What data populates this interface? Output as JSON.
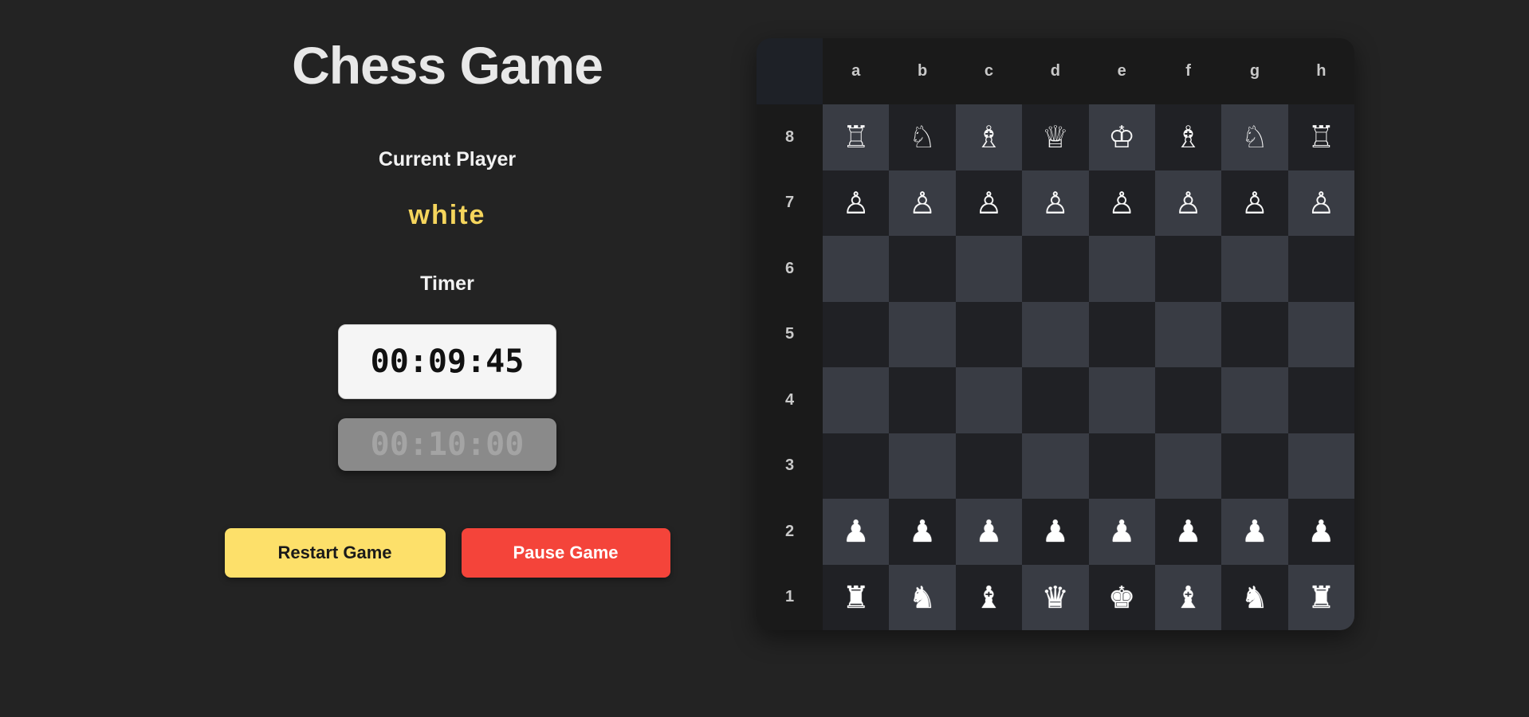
{
  "title": "Chess Game",
  "current_player_label": "Current Player",
  "current_player": "white",
  "timer_label": "Timer",
  "timers": {
    "active": "00:09:45",
    "inactive": "00:10:00"
  },
  "buttons": {
    "restart": "Restart Game",
    "pause": "Pause Game"
  },
  "board": {
    "files": [
      "a",
      "b",
      "c",
      "d",
      "e",
      "f",
      "g",
      "h"
    ],
    "ranks": [
      "8",
      "7",
      "6",
      "5",
      "4",
      "3",
      "2",
      "1"
    ],
    "pieces": [
      [
        "♖",
        "♘",
        "♗",
        "♕",
        "♔",
        "♗",
        "♘",
        "♖"
      ],
      [
        "♙",
        "♙",
        "♙",
        "♙",
        "♙",
        "♙",
        "♙",
        "♙"
      ],
      [
        "",
        "",
        "",
        "",
        "",
        "",
        "",
        ""
      ],
      [
        "",
        "",
        "",
        "",
        "",
        "",
        "",
        ""
      ],
      [
        "",
        "",
        "",
        "",
        "",
        "",
        "",
        ""
      ],
      [
        "",
        "",
        "",
        "",
        "",
        "",
        "",
        ""
      ],
      [
        "♟",
        "♟",
        "♟",
        "♟",
        "♟",
        "♟",
        "♟",
        "♟"
      ],
      [
        "♜",
        "♞",
        "♝",
        "♛",
        "♚",
        "♝",
        "♞",
        "♜"
      ]
    ]
  },
  "colors": {
    "background": "#232323",
    "accent_yellow": "#fde06a",
    "current_player": "#f5d55c",
    "pause_red": "#f4443a",
    "light_square": "#393c44",
    "dark_square": "#202125"
  }
}
